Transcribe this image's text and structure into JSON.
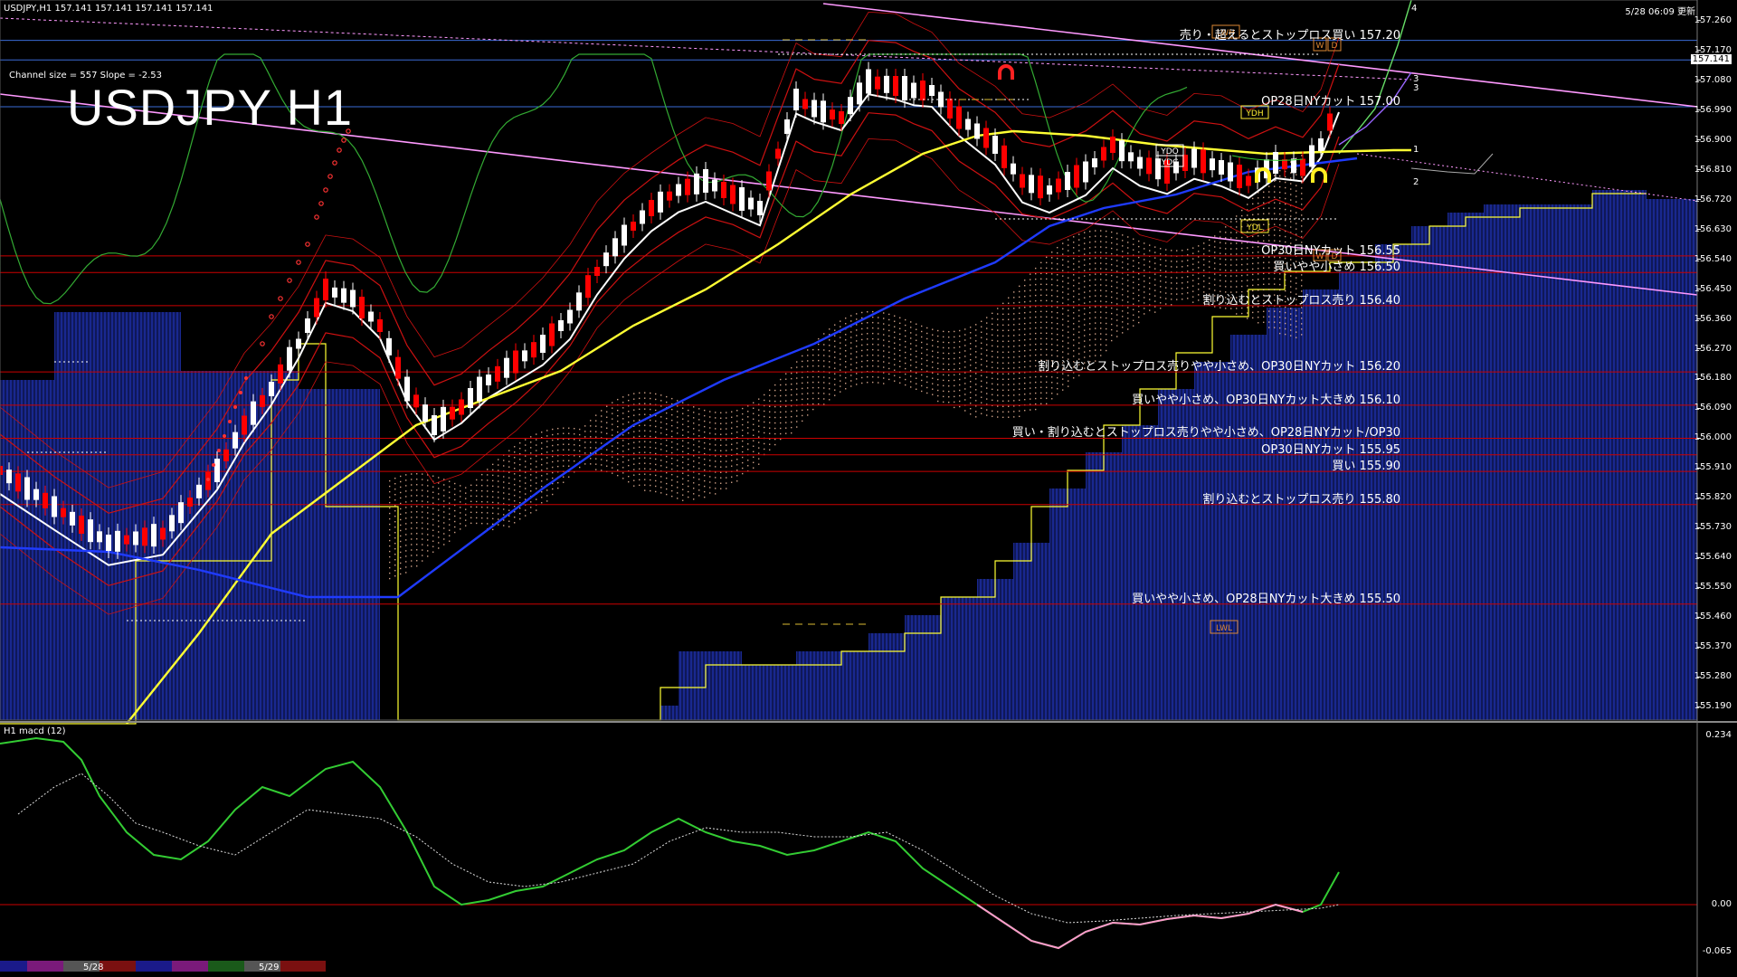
{
  "header": {
    "symbol_line": "USDJPY,H1  157.141 157.141 157.141 157.141",
    "datetime": "5/28 06:09 更新",
    "channel_info": "Channel size = 557 Slope = -2.53",
    "title": "USDJPY H1",
    "macd_label": "H1  macd (12)"
  },
  "colors": {
    "background": "#000000",
    "candle_up": "#ffffff",
    "candle_down": "#ff0000",
    "support_line": "#cc0000",
    "blue_line": "#3a6bd6",
    "cloud_fill": "#1d2fa8",
    "channel": "#ff99ff",
    "ma_white": "#ffffff",
    "ma_yellow": "#ffff33",
    "ma_blue": "#1f3bff",
    "macd_green": "#33cc33",
    "macd_pink": "#ff99cc"
  },
  "annotations": [
    {
      "price": 157.2,
      "text": "売り・超えるとストップロス買い 157.20"
    },
    {
      "price": 157.0,
      "text": "OP28日NYカット 157.00"
    },
    {
      "price": 156.55,
      "text": "OP30日NYカット 156.55"
    },
    {
      "price": 156.5,
      "text": "買いやや小さめ 156.50"
    },
    {
      "price": 156.4,
      "text": "割り込むとストップロス売り 156.40"
    },
    {
      "price": 156.2,
      "text": "割り込むとストップロス売りやや小さめ、OP30日NYカット 156.20"
    },
    {
      "price": 156.1,
      "text": "買いやや小さめ、OP30日NYカット大きめ 156.10"
    },
    {
      "price": 156.0,
      "text": "買い・割り込むとストップロス売りやや小さめ、OP28日NYカット/OP30"
    },
    {
      "price": 155.95,
      "text": "OP30日NYカット 155.95"
    },
    {
      "price": 155.9,
      "text": "買い 155.90"
    },
    {
      "price": 155.8,
      "text": "割り込むとストップロス売り 155.80"
    },
    {
      "price": 155.5,
      "text": "買いやや小さめ、OP28日NYカット大きめ 155.50"
    }
  ],
  "tags": {
    "lwh": "LWH",
    "lwl": "LWL",
    "ydh": "YDH",
    "ydl": "YDL",
    "ydo": "YDO",
    "ydc": "YDC",
    "w": "W",
    "d": "D",
    "n1": "1",
    "n2": "2",
    "n3": "3",
    "n4": "4"
  },
  "chart_data": {
    "type": "candlestick",
    "symbol": "USDJPY",
    "timeframe": "H1",
    "last_price": 157.141,
    "y_axis_ticks": [
      157.26,
      157.17,
      157.08,
      156.99,
      156.9,
      156.81,
      156.72,
      156.63,
      156.54,
      156.45,
      156.36,
      156.27,
      156.18,
      156.09,
      156.0,
      155.91,
      155.82,
      155.73,
      155.64,
      155.55,
      155.46,
      155.37,
      155.28,
      155.19
    ],
    "y_axis_labels": [
      "157.260",
      "157.170",
      "157.141",
      "157.080",
      "156.990",
      "156.900",
      "156.810",
      "156.720",
      "156.630",
      "156.540",
      "156.450",
      "156.360",
      "156.270",
      "156.180",
      "156.090",
      "156.000",
      "155.910",
      "155.820",
      "155.730",
      "155.640",
      "155.550",
      "155.460",
      "155.370",
      "155.280",
      "155.190"
    ],
    "ylim": [
      155.15,
      157.3
    ],
    "horizontal_levels": [
      157.2,
      157.141,
      157.0,
      156.55,
      156.5,
      156.4,
      156.2,
      156.1,
      156.0,
      155.95,
      155.9,
      155.8,
      155.5
    ],
    "x_labels": [
      "5/28",
      "5/29"
    ],
    "macd": {
      "ticks": [
        "0.234",
        "0.00",
        "-0.065"
      ],
      "ylim": [
        -0.07,
        0.24
      ]
    }
  }
}
